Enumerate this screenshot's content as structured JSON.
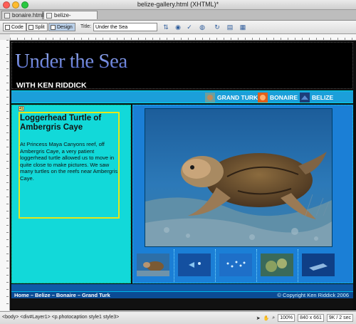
{
  "window": {
    "title": "belize-gallery.html (XHTML)*"
  },
  "tabs": [
    {
      "label": "bonaire.html"
    },
    {
      "label": "belize-gallery.html*"
    }
  ],
  "toolbar": {
    "code_label": "Code",
    "split_label": "Split",
    "design_label": "Design",
    "title_label": "Title:",
    "title_value": "Under the Sea"
  },
  "page": {
    "heading": "Under the Sea",
    "subheading": "WITH KEN RIDDICK",
    "nav": [
      {
        "label": "GRAND TURK",
        "color": "#c08a5a"
      },
      {
        "label": "BONAIRE",
        "color": "#e0601a"
      },
      {
        "label": "BELIZE",
        "color": "#1c3e7a"
      }
    ],
    "layer_marker": "41",
    "caption_title": "Loggerhead Turtle of Ambergris Caye",
    "caption_body": "At Princess Maya Canyons reef, off Ambergris Caye, a very patient loggerhead turtle allowed us to move in quite close to make pictures. We saw many turtles on the reefs near Ambergris Caye.",
    "footer_links": [
      "Home",
      "Belize",
      "Bonaire",
      "Grand Turk"
    ],
    "footer_sep": "–",
    "copyright": "© Copyright Ken Riddick 2006"
  },
  "statusbar": {
    "tags": "<body> <div#Layer1> <p.photocaption style1 style3>",
    "zoom": "100%",
    "dimensions": "840 x 661",
    "size": "9K / 2 sec"
  },
  "colors": {
    "page_bg": "#000000",
    "left_pane": "#12d9d9",
    "right_pane": "#1b7fd6",
    "caption_border": "#e6e61a"
  }
}
